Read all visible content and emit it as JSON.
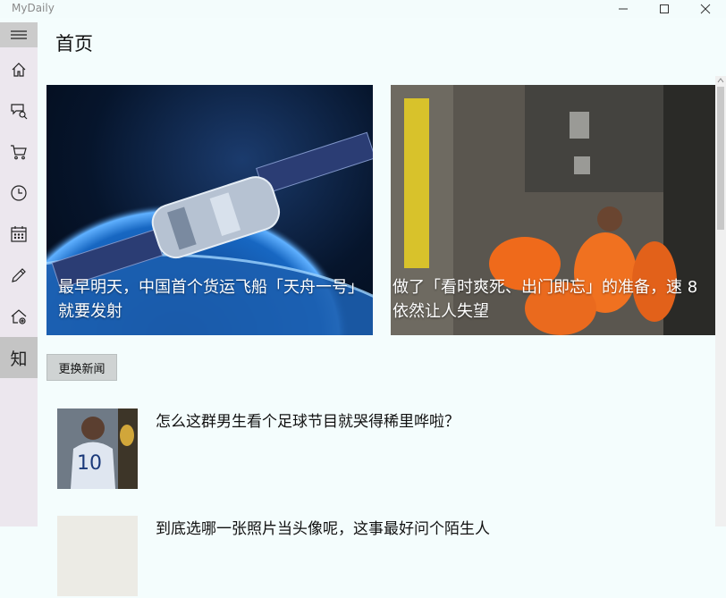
{
  "app": {
    "title": "MyDaily"
  },
  "window_controls": [
    "minimize",
    "maximize",
    "close"
  ],
  "sidebar": {
    "items": [
      {
        "icon": "hamburger-menu-icon"
      },
      {
        "icon": "home-icon"
      },
      {
        "icon": "chat-search-icon"
      },
      {
        "icon": "shopping-cart-icon"
      },
      {
        "icon": "clock-icon"
      },
      {
        "icon": "calendar-icon"
      },
      {
        "icon": "pencil-icon"
      },
      {
        "icon": "home-settings-icon"
      },
      {
        "label": "知",
        "active": true
      }
    ]
  },
  "page": {
    "title": "首页"
  },
  "hero": [
    {
      "caption": "最早明天，中国首个货运飞船「天舟一号」就要发射",
      "image": "space-station-orbit"
    },
    {
      "caption": "做了「看时爽死、出门即忘」的准备，速 8 依然让人失望",
      "image": "prison-fight-scene"
    }
  ],
  "switch_button": {
    "label": "更换新闻"
  },
  "news": [
    {
      "title": "怎么这群男生看个足球节目就哭得稀里哗啦？",
      "image": "footballer-jersey-10"
    },
    {
      "title": "到底选哪一张照片当头像呢，这事最好问个陌生人",
      "image": "portrait-thumb"
    }
  ],
  "colors": {
    "background": "#f4fdfd",
    "sidebar": "#ece7ee",
    "sidebar_active": "#c4c4c4"
  }
}
